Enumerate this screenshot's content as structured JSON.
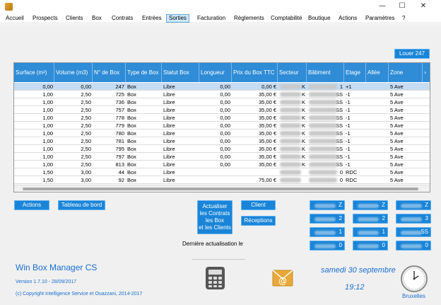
{
  "window": {
    "minimize": "—",
    "maximize": "☐",
    "close": "✕"
  },
  "menu": [
    "Accueil",
    "Prospects",
    "Clients",
    "Box",
    "Contrats",
    "Entrées",
    "Sorties",
    "Facturation",
    "Règlements",
    "Comptabilité",
    "Boutique",
    "Actions",
    "Paramètres",
    "?"
  ],
  "louer_button": "Louer 247",
  "grid": {
    "columns": [
      "Surface (m²)",
      "Volume (m3)",
      "N° de Box",
      "Type de Box",
      "Statut Box",
      "Longueur",
      "Prix du Box TTC",
      "Secteur",
      "Bâtiment",
      "Etage",
      "Allée",
      "Zone"
    ],
    "rows": [
      [
        "0,00",
        "0,00",
        "247",
        "Box",
        "Libre",
        "0,00",
        "0,00 €",
        "K",
        "1",
        "+1",
        "",
        "5 Ave"
      ],
      [
        "1,00",
        "2,50",
        "725",
        "Box",
        "Libre",
        "0,00",
        "35,00 €",
        "K",
        "SS",
        "-1",
        "",
        "5 Ave"
      ],
      [
        "1,00",
        "2,50",
        "736",
        "Box",
        "Libre",
        "0,00",
        "35,00 €",
        "K",
        "SS",
        "-1",
        "",
        "5 Ave"
      ],
      [
        "1,00",
        "2,50",
        "757",
        "Box",
        "Libre",
        "0,00",
        "35,00 €",
        "K",
        "SS",
        "-1",
        "",
        "5 Ave"
      ],
      [
        "1,00",
        "2,50",
        "778",
        "Box",
        "Libre",
        "0,00",
        "35,00 €",
        "K",
        "SS",
        "-1",
        "",
        "5 Ave"
      ],
      [
        "1,00",
        "2,50",
        "779",
        "Box",
        "Libre",
        "0,00",
        "35,00 €",
        "K",
        "SS",
        "-1",
        "",
        "5 Ave"
      ],
      [
        "1,00",
        "2,50",
        "780",
        "Box",
        "Libre",
        "0,00",
        "35,00 €",
        "K",
        "SS",
        "-1",
        "",
        "5 Ave"
      ],
      [
        "1,00",
        "2,50",
        "781",
        "Box",
        "Libre",
        "0,00",
        "35,00 €",
        "K",
        "SS",
        "-1",
        "",
        "5 Ave"
      ],
      [
        "1,00",
        "2,50",
        "795",
        "Box",
        "Libre",
        "0,00",
        "35,00 €",
        "K",
        "SS",
        "-1",
        "",
        "5 Ave"
      ],
      [
        "1,00",
        "2,50",
        "797",
        "Box",
        "Libre",
        "0,00",
        "35,00 €",
        "K",
        "SS",
        "-1",
        "",
        "5 Ave"
      ],
      [
        "1,00",
        "2,50",
        "813",
        "Box",
        "Libre",
        "0,00",
        "35,00 €",
        "K",
        "SS",
        "-1",
        "",
        "5 Ave"
      ],
      [
        "1,50",
        "3,00",
        "44",
        "Box",
        "Libre",
        "",
        "",
        "",
        "0",
        "RDC",
        "",
        "5 Ave"
      ],
      [
        "1,50",
        "3,00",
        "92",
        "Box",
        "Libre",
        "",
        "75,00 €",
        "",
        "0",
        "RDC",
        "",
        "5 Ave"
      ]
    ]
  },
  "buttons": {
    "actions": "Actions",
    "tableau": "Tableau de bord",
    "actualiser": [
      "Actualiser",
      "les Contrats",
      "les Box",
      "et les Clients"
    ],
    "client": "Client",
    "receptions": "Réceptions",
    "sites": [
      "Z",
      "Z",
      "Z",
      "2",
      "2",
      "3",
      "1",
      "1",
      "SS",
      "0",
      "0",
      "0"
    ]
  },
  "last_refresh": "Dernière actualisation le",
  "app_name": "Win Box Manager CS",
  "version": "Version 1.7.10 - 28/09/2017",
  "copyright": "(c) Copyright Intelligence Service et Ouazzani, 2014-2017",
  "date": "samedi 30 septembre",
  "time": "19:12",
  "city": "Bruxelles",
  "icons": {
    "calculator": "calculator-icon",
    "mail": "mail-icon",
    "clock": "clock-icon"
  }
}
